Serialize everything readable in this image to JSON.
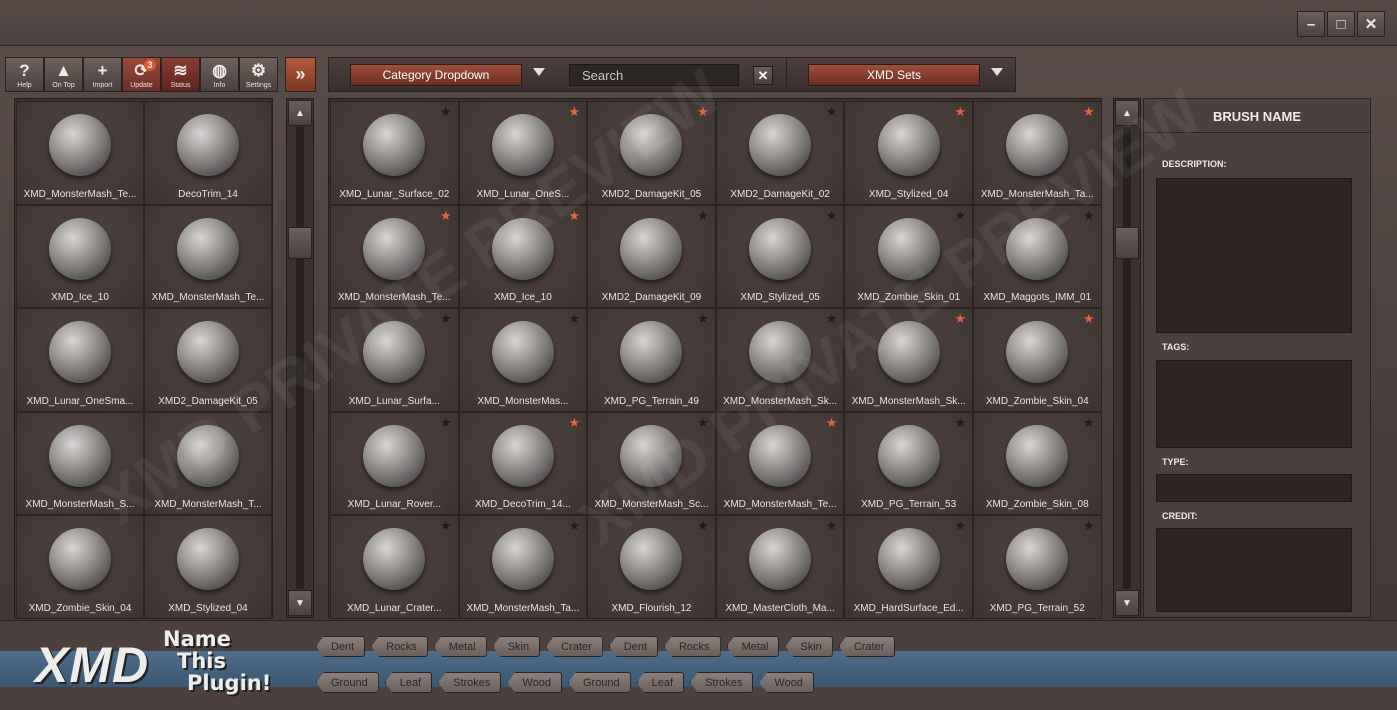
{
  "window": {
    "controls": [
      "minimize",
      "maximize",
      "close"
    ]
  },
  "toolbar": {
    "buttons": [
      {
        "label": "Help",
        "icon": "?"
      },
      {
        "label": "On Top",
        "icon": "▲"
      },
      {
        "label": "Import",
        "icon": "+"
      },
      {
        "label": "Update",
        "icon": "⟳",
        "badge": "3"
      },
      {
        "label": "Status",
        "icon": "≋"
      },
      {
        "label": "Info",
        "icon": "◍"
      },
      {
        "label": "Settings",
        "icon": "⚙"
      }
    ],
    "expand_icon": "»"
  },
  "controls": {
    "category_dropdown": "Category Dropdown",
    "search_placeholder": "Search",
    "clear_icon": "✕",
    "sets_dropdown": "XMD Sets"
  },
  "left_grid": [
    {
      "label": "XMD_MonsterMash_Te..."
    },
    {
      "label": "DecoTrim_14"
    },
    {
      "label": "XMD_Ice_10"
    },
    {
      "label": "XMD_MonsterMash_Te..."
    },
    {
      "label": "XMD_Lunar_OneSma..."
    },
    {
      "label": "XMD2_DamageKit_05"
    },
    {
      "label": "XMD_MonsterMash_S..."
    },
    {
      "label": "XMD_MonsterMash_T..."
    },
    {
      "label": "XMD_Zombie_Skin_04"
    },
    {
      "label": "XMD_Stylized_04"
    }
  ],
  "main_grid": [
    {
      "label": "XMD_Lunar_Surface_02",
      "fav": false
    },
    {
      "label": "XMD_Lunar_OneS...",
      "fav": true
    },
    {
      "label": "XMD2_DamageKit_05",
      "fav": true
    },
    {
      "label": "XMD2_DamageKit_02",
      "fav": false
    },
    {
      "label": "XMD_Stylized_04",
      "fav": true
    },
    {
      "label": "XMD_MonsterMash_Ta...",
      "fav": true
    },
    {
      "label": "XMD_MonsterMash_Te...",
      "fav": true
    },
    {
      "label": "XMD_Ice_10",
      "fav": true
    },
    {
      "label": "XMD2_DamageKit_09",
      "fav": false
    },
    {
      "label": "XMD_Stylized_05",
      "fav": false
    },
    {
      "label": "XMD_Zombie_Skin_01",
      "fav": false
    },
    {
      "label": "XMD_Maggots_IMM_01",
      "fav": false
    },
    {
      "label": "XMD_Lunar_Surfa...",
      "fav": false
    },
    {
      "label": "XMD_MonsterMas...",
      "fav": false
    },
    {
      "label": "XMD_PG_Terrain_49",
      "fav": false
    },
    {
      "label": "XMD_MonsterMash_Sk...",
      "fav": false
    },
    {
      "label": "XMD_MonsterMash_Sk...",
      "fav": true
    },
    {
      "label": "XMD_Zombie_Skin_04",
      "fav": true
    },
    {
      "label": "XMD_Lunar_Rover...",
      "fav": false
    },
    {
      "label": "XMD_DecoTrim_14...",
      "fav": true
    },
    {
      "label": "XMD_MonsterMash_Sc...",
      "fav": false
    },
    {
      "label": "XMD_MonsterMash_Te...",
      "fav": true
    },
    {
      "label": "XMD_PG_Terrain_53",
      "fav": false
    },
    {
      "label": "XMD_Zombie_Skin_08",
      "fav": false
    },
    {
      "label": "XMD_Lunar_Crater...",
      "fav": false
    },
    {
      "label": "XMD_MonsterMash_Ta...",
      "fav": false
    },
    {
      "label": "XMD_Flourish_12",
      "fav": false
    },
    {
      "label": "XMD_MasterCloth_Ma...",
      "fav": false
    },
    {
      "label": "XMD_HardSurface_Ed...",
      "fav": false
    },
    {
      "label": "XMD_PG_Terrain_52",
      "fav": false
    }
  ],
  "info_panel": {
    "brush_name": "BRUSH NAME",
    "description_label": "DESCRIPTION:",
    "tags_label": "TAGS:",
    "type_label": "TYPE:",
    "credit_label": "CREDIT:"
  },
  "branding": {
    "logo": "XMD",
    "tagline": [
      "Name",
      "This",
      "Plugin!"
    ]
  },
  "tags_row1": [
    "Dent",
    "Rocks",
    "Metal",
    "Skin",
    "Crater",
    "Dent",
    "Rocks",
    "Metal",
    "Skin",
    "Crater"
  ],
  "tags_row2": [
    "Ground",
    "Leaf",
    "Strokes",
    "Wood",
    "Ground",
    "Leaf",
    "Strokes",
    "Wood"
  ],
  "watermark": "XMD PRIVATE PREVIEW",
  "colors": {
    "accent": "#a04f3b",
    "star_on": "#e0623e",
    "stripe": "#4f6e8c"
  }
}
